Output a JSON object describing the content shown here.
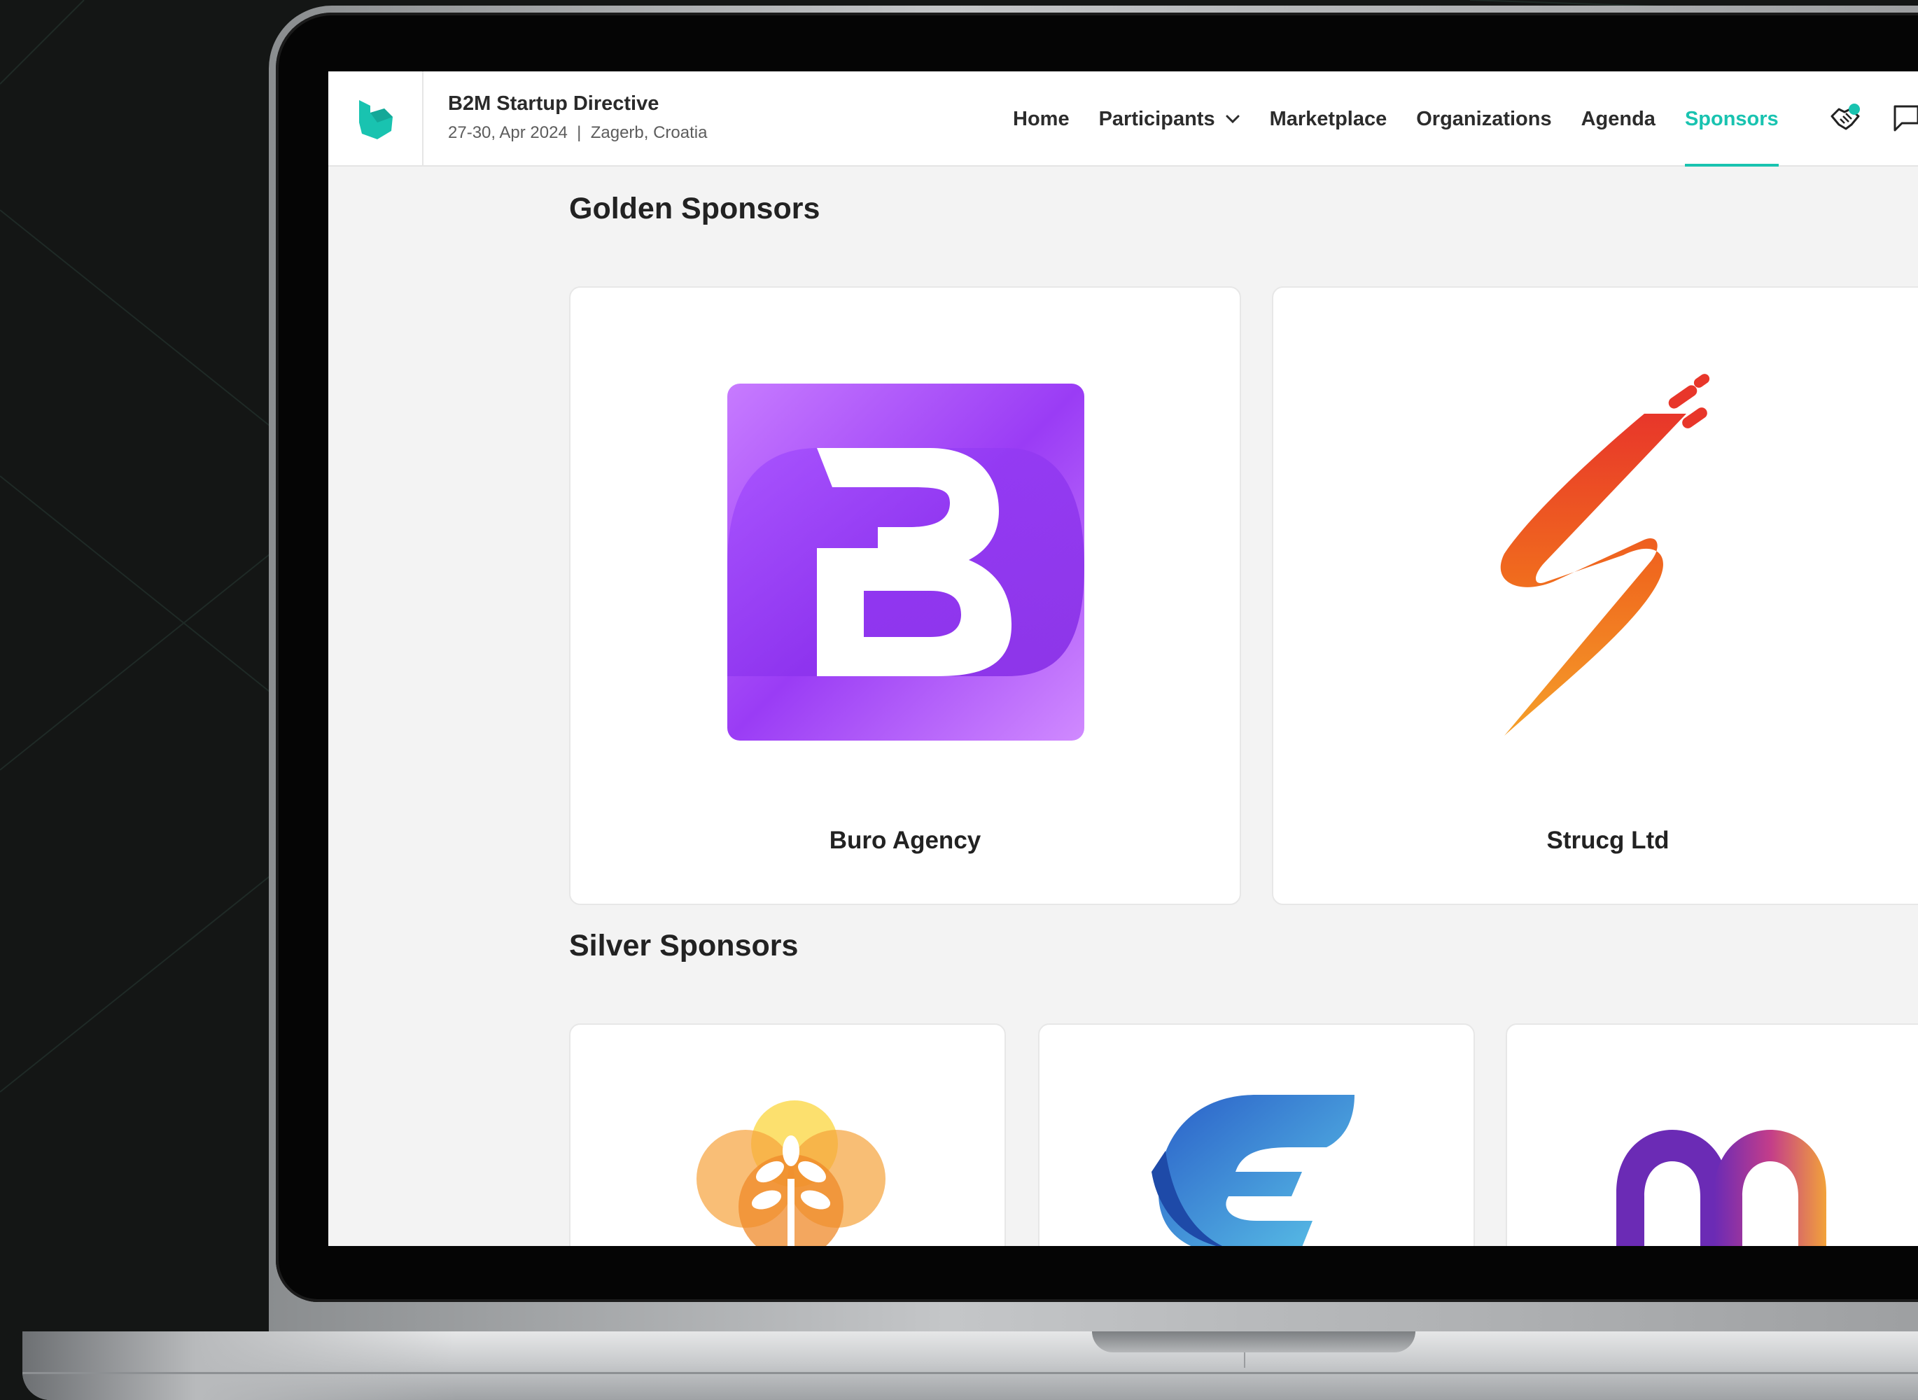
{
  "header": {
    "event_title": "B2M Startup Directive",
    "event_subtitle": "27-30, Apr 2024  |  Zagerb, Croatia"
  },
  "nav": {
    "items": [
      {
        "label": "Home"
      },
      {
        "label": "Participants"
      },
      {
        "label": "Marketplace"
      },
      {
        "label": "Organizations"
      },
      {
        "label": "Agenda"
      },
      {
        "label": "Sponsors"
      }
    ],
    "active": "Sponsors"
  },
  "sections": {
    "golden": {
      "title": "Golden Sponsors",
      "sponsors": [
        {
          "name": "Buro Agency",
          "logo": "b-letter-logo"
        },
        {
          "name": "Strucg Ltd",
          "logo": "lightning-logo"
        }
      ]
    },
    "silver": {
      "title": "Silver Sponsors",
      "sponsors": [
        {
          "logo": "tree-logo"
        },
        {
          "logo": "c-wing-logo"
        },
        {
          "logo": "m-rainbow-logo"
        }
      ]
    }
  },
  "colors": {
    "accent": "#19c3b0",
    "page_bg": "#f3f3f3",
    "card_bg": "#ffffff"
  },
  "icons": [
    "brand-logo-icon",
    "chevron-down-icon",
    "handshake-icon",
    "chat-icon"
  ]
}
